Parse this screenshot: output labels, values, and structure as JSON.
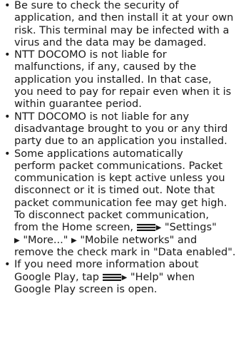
{
  "bullet_char": "•",
  "arrow_char": "▶",
  "items": [
    {
      "lines": [
        "Be sure to check the security of",
        "application, and then install it at your own",
        "risk. This terminal may be infected with a",
        "virus and the data may be damaged."
      ]
    },
    {
      "lines": [
        "NTT DOCOMO is not liable for",
        "malfunctions, if any, caused by the",
        "application you installed. In that case,",
        "you need to pay for repair even when it is",
        "within guarantee period."
      ]
    },
    {
      "lines": [
        "NTT DOCOMO is not liable for any",
        "disadvantage brought to you or any third",
        "party due to an application you installed."
      ]
    },
    {
      "lines": [
        "Some applications automatically",
        "perform packet communications. Packet",
        "communication is kept active unless you",
        "disconnect or it is timed out. Note that",
        "packet communication fee may get high.",
        "To disconnect packet communication,"
      ],
      "line7": {
        "before": "from the Home screen,",
        "after": "\"Settings\""
      },
      "line8": {
        "text": "\"More...\"",
        "after": "\"Mobile networks\" and"
      },
      "line9": "remove the check mark in \"Data enabled\"."
    },
    {
      "lines": [
        "If you need more information about"
      ],
      "line2": {
        "before": "Google Play, tap",
        "after": "\"Help\" when"
      },
      "line3": "Google Play screen is open."
    }
  ]
}
